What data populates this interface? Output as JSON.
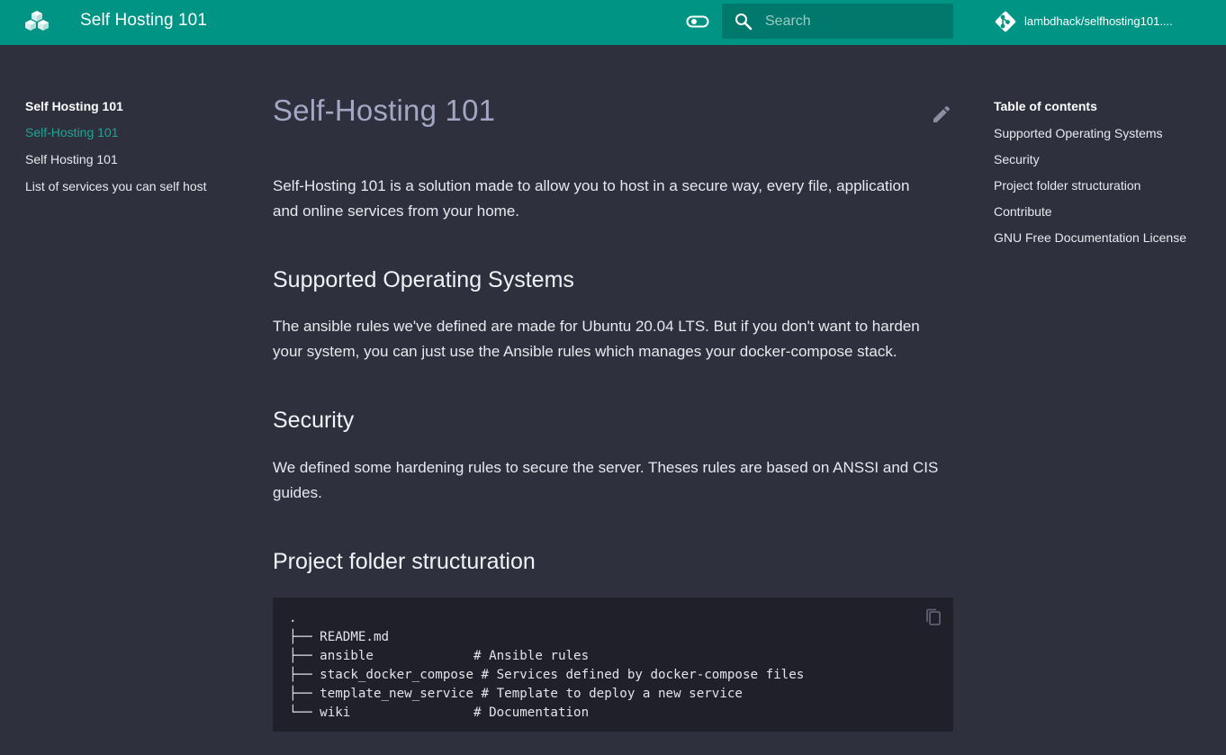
{
  "header": {
    "site_title": "Self Hosting 101",
    "search_placeholder": "Search",
    "repo_name": "lambdhack/selfhosting101....",
    "accent_color": "#009485",
    "icons": [
      "logo-icon",
      "theme-toggle-icon",
      "search-icon",
      "git-icon"
    ]
  },
  "nav": {
    "title": "Self Hosting 101",
    "items": [
      {
        "label": "Self-Hosting 101",
        "active": true
      },
      {
        "label": "Self Hosting 101",
        "active": false
      },
      {
        "label": "List of services you can self host",
        "active": false
      }
    ]
  },
  "toc": {
    "title": "Table of contents",
    "items": [
      "Supported Operating Systems",
      "Security",
      "Project folder structuration",
      "Contribute",
      "GNU Free Documentation License"
    ]
  },
  "content": {
    "title": "Self-Hosting 101",
    "intro": "Self-Hosting 101 is a solution made to allow you to host in a secure way, every file, application and online services from your home.",
    "sections": [
      {
        "heading": "Supported Operating Systems",
        "text": "The ansible rules we've defined are made for Ubuntu 20.04 LTS. But if you don't want to harden your system, you can just use the Ansible rules which manages your docker-compose stack."
      },
      {
        "heading": "Security",
        "text": "We defined some hardening rules to secure the server. Theses rules are based on ANSSI and CIS guides."
      },
      {
        "heading": "Project folder structuration",
        "text": ""
      }
    ],
    "code": ".\n├── README.md\n├── ansible             # Ansible rules\n├── stack_docker_compose # Services defined by docker-compose files\n├── template_new_service # Template to deploy a new service\n└── wiki                # Documentation"
  }
}
